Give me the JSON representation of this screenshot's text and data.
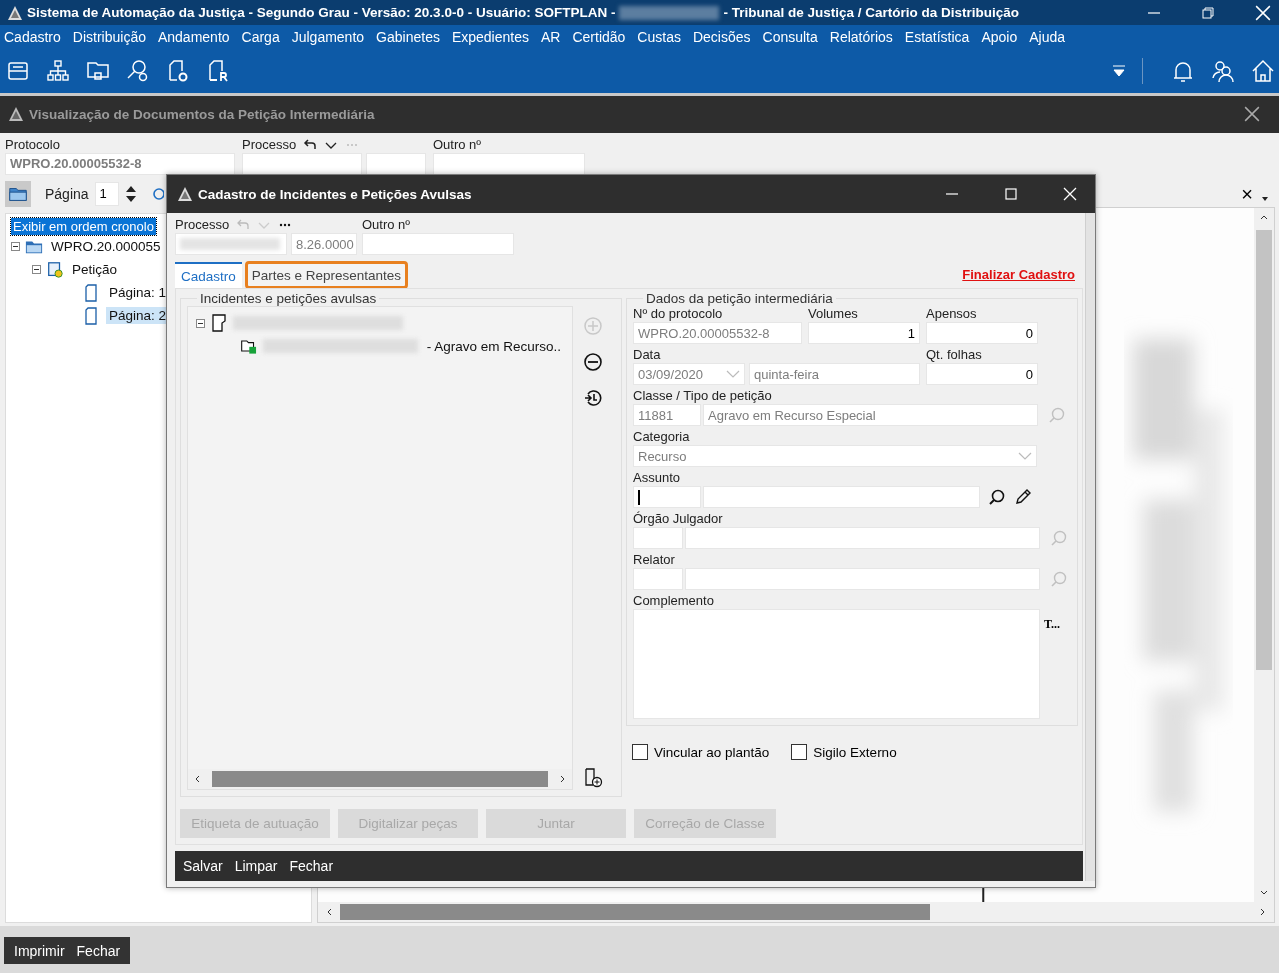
{
  "window": {
    "title_start": "Sistema de Automação da Justiça - Segundo Grau - Versão: 20.3.0-0 - Usuário: SOFTPLAN -",
    "title_end": "- Tribunal de Justiça / Cartório da Distribuição"
  },
  "menu": [
    "Cadastro",
    "Distribuição",
    "Andamento",
    "Carga",
    "Julgamento",
    "Gabinetes",
    "Expedientes",
    "AR",
    "Certidão",
    "Custas",
    "Decisões",
    "Consulta",
    "Relatórios",
    "Estatística",
    "Apoio",
    "Ajuda"
  ],
  "viewer": {
    "title": "Visualização de Documentos da Petição Intermediária",
    "protocolo_label": "Protocolo",
    "protocolo_value": "WPRO.20.00005532-8",
    "processo_label": "Processo",
    "outro_label": "Outro nº",
    "page_label": "Página",
    "page_value": "1",
    "order_option": {
      "label": "Exibir em ordem cronolo",
      "selected": true
    },
    "tree": [
      {
        "label": "WPRO.20.000055",
        "expanded": true,
        "selected": false,
        "children": [
          {
            "label": "Petição",
            "expanded": true,
            "selected": false,
            "children": [
              {
                "label": "Página: 1",
                "selected": false
              },
              {
                "label": "Página: 2",
                "selected": true
              }
            ]
          }
        ]
      }
    ],
    "close_glyph": "×",
    "buttons": [
      "Imprimir",
      "Fechar"
    ]
  },
  "dialog": {
    "title": "Cadastro de Incidentes e Petições Avulsas",
    "processo_label": "Processo",
    "processo_suffix": "8.26.0000",
    "outro_label": "Outro nº",
    "tabs": [
      {
        "label": "Cadastro",
        "selected": true,
        "highlighted": false
      },
      {
        "label": "Partes e Representantes",
        "selected": false,
        "highlighted": true
      }
    ],
    "finish_link": "Finalizar Cadastro",
    "list_group": {
      "title": "Incidentes e petições avulsas",
      "items": [
        {
          "expanded": true,
          "children": [
            {
              "suffix": "- Agravo em Recurso.."
            }
          ]
        }
      ],
      "add_disabled": true
    },
    "data_group": {
      "title": "Dados da petição intermediária",
      "protocolo": {
        "label": "Nº do protocolo",
        "value": "WPRO.20.00005532-8"
      },
      "volumes": {
        "label": "Volumes",
        "value": "1"
      },
      "apensos": {
        "label": "Apensos",
        "value": "0"
      },
      "data": {
        "label": "Data",
        "value": "03/09/2020",
        "weekday": "quinta-feira"
      },
      "folhas": {
        "label": "Qt. folhas",
        "value": "0"
      },
      "classe": {
        "label": "Classe / Tipo de petição",
        "code": "11881",
        "name": "Agravo em Recurso Especial"
      },
      "categoria": {
        "label": "Categoria",
        "value": "Recurso"
      },
      "assunto": {
        "label": "Assunto"
      },
      "orgao": {
        "label": "Órgão Julgador"
      },
      "relator": {
        "label": "Relator"
      },
      "complemento": {
        "label": "Complemento",
        "side": "T..."
      }
    },
    "checkboxes": [
      {
        "label": "Vincular ao plantão",
        "checked": false
      },
      {
        "label": "Sigilo Externo",
        "checked": false
      }
    ],
    "actions": [
      {
        "label": "Etiqueta de autuação",
        "disabled": true
      },
      {
        "label": "Digitalizar peças",
        "disabled": true
      },
      {
        "label": "Juntar",
        "disabled": true
      },
      {
        "label": "Correção de Classe",
        "disabled": true
      }
    ],
    "footer": [
      "Salvar",
      "Limpar",
      "Fechar"
    ]
  }
}
